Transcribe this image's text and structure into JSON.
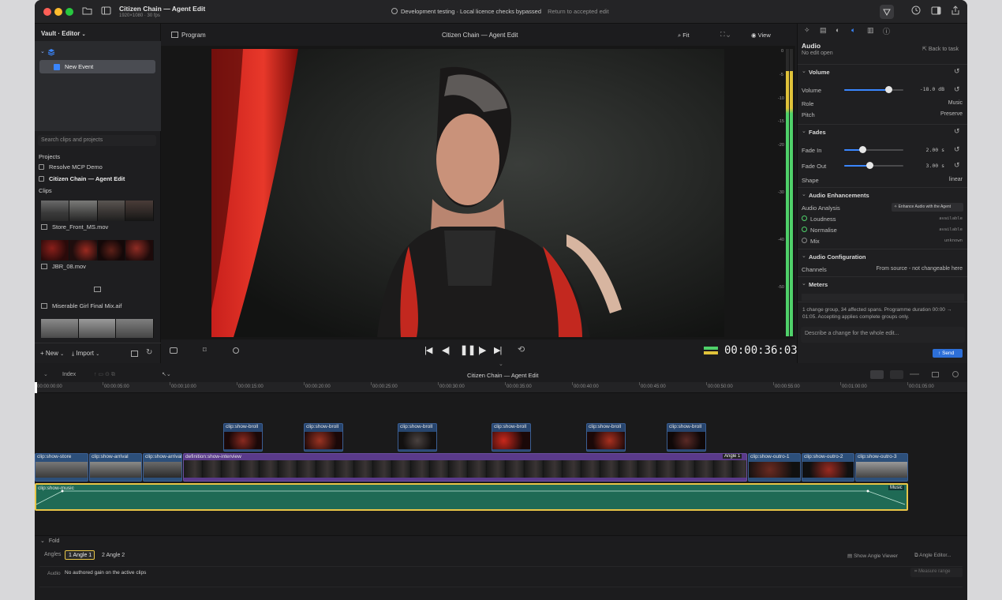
{
  "titlebar": {
    "project_title": "Citizen Chain — Agent Edit",
    "project_meta": "1920×1080 · 30 fps",
    "notice": "Development testing · Local licence checks bypassed",
    "notice_link": "Return to accepted edit"
  },
  "sidebar": {
    "vault_menu": "Vault · Editor",
    "event_label": "New Event",
    "search_placeholder": "Search clips and projects",
    "projects_heading": "Projects",
    "projects": [
      "Resolve MCP Demo",
      "Citizen Chain — Agent Edit"
    ],
    "clips_heading": "Clips",
    "clips": [
      "Store_Front_MS.mov",
      "JBR_08.mov",
      "Miserable Girl Final Mix.aif"
    ],
    "new_button": "New",
    "import_button": "Import"
  },
  "program": {
    "tab": "Program",
    "title": "Citizen Chain — Agent Edit",
    "fit": "Fit",
    "view": "View",
    "timecode": "00:00:36:03"
  },
  "meter_scale": [
    "0",
    "-5",
    "-10",
    "-15",
    "-20",
    "-30",
    "-40",
    "-50"
  ],
  "inspector": {
    "heading": "Audio",
    "subheading": "No edit open",
    "back": "Back to task",
    "volume_section": "Volume",
    "volume_label": "Volume",
    "volume_value": "-18.0 dB",
    "volume_level": 0.75,
    "role_label": "Role",
    "role_value": "Music",
    "pitch_label": "Pitch",
    "pitch_value": "Preserve",
    "fades_section": "Fades",
    "fade_in_label": "Fade In",
    "fade_in_value": "2.00 s",
    "fade_in_level": 0.3,
    "fade_out_label": "Fade Out",
    "fade_out_value": "3.00 s",
    "fade_out_level": 0.42,
    "shape_label": "Shape",
    "shape_value": "linear",
    "enh_section": "Audio Enhancements",
    "analysis_label": "Audio Analysis",
    "enhance_button": "Enhance Audio with the Agent",
    "loudness_label": "Loudness",
    "loudness_value": "available",
    "normalise_label": "Normalise",
    "normalise_value": "available",
    "mix_label": "Mix",
    "mix_value": "unknown",
    "config_section": "Audio Configuration",
    "channels_label": "Channels",
    "channels_value": "From source - not changeable here",
    "meters_section": "Meters",
    "summary": "1 change group, 34 affected spans. Programme duration 00:00 → 01:05. Accepting applies complete groups only.",
    "prompt_placeholder": "Describe a change for the whole edit...",
    "send_button": "Send"
  },
  "timeline": {
    "index_label": "Index",
    "title": "Citizen Chain — Agent Edit",
    "ruler": [
      "00:00:00:00",
      "00:00:05:00",
      "00:00:10:00",
      "00:00:15:00",
      "00:00:20:00",
      "00:00:25:00",
      "00:00:30:00",
      "00:00:35:00",
      "00:00:40:00",
      "00:00:45:00",
      "00:00:50:00",
      "00:00:55:00",
      "00:01:00:00",
      "00:01:05:00"
    ],
    "broll_label": "clip:show-broll",
    "primary_clips": [
      "clip:show-store",
      "clip:show-arrival",
      "clip:show-arrival",
      "definition:show-interview",
      "clip:show-outro-1",
      "clip:show-outro-2",
      "clip:show-outro-3"
    ],
    "angle_badge": "Angle 1",
    "music_clip": "clip:show-music",
    "music_badge": "Music"
  },
  "bottom": {
    "fold": "Fold",
    "angles_label": "Angles",
    "angle1": "1 Angle 1",
    "angle2": "2 Angle 2",
    "show_angle_viewer": "Show Angle Viewer",
    "angle_editor": "Angle Editor...",
    "audio_label": "Audio",
    "audio_note": "No authored gain on the active clips",
    "measure": "Measure range"
  },
  "colors": {
    "accent": "#3a86ff",
    "meter_green": "#4fd16a",
    "meter_yellow": "#e0c23a",
    "music_track": "#1f6a55",
    "interview_bar": "#6b3fa0",
    "selection": "#e8c547"
  }
}
